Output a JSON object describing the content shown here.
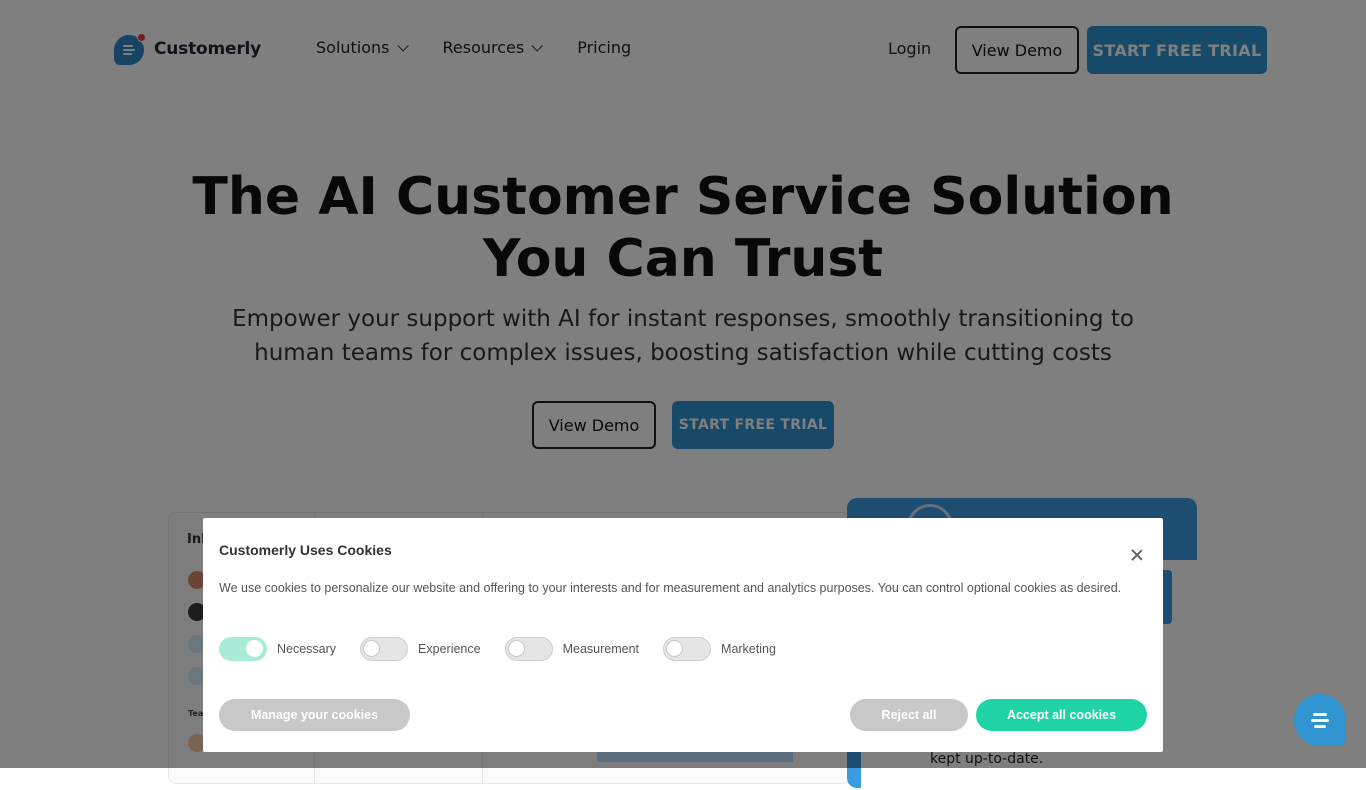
{
  "brand": {
    "name": "Customerly"
  },
  "nav": {
    "items": [
      {
        "label": "Solutions",
        "dropdown": true
      },
      {
        "label": "Resources",
        "dropdown": true
      },
      {
        "label": "Pricing",
        "dropdown": false
      }
    ],
    "login_label": "Login",
    "view_demo_label": "View Demo",
    "trial_label": "START FREE TRIAL"
  },
  "hero": {
    "title": "The AI Customer Service Solution You Can Trust",
    "subtitle": "Empower your support with AI for instant responses, smoothly transitioning to human teams for complex issues, boosting satisfaction while cutting costs",
    "view_demo_label": "View Demo",
    "trial_label": "START FREE TRIAL"
  },
  "preview": {
    "inbox_label": "Inb",
    "teams_label": "Team",
    "message_snippet": "kept up-to-date."
  },
  "cookie_banner": {
    "title": "Customerly Uses Cookies",
    "text": "We use cookies to personalize our website and offering to your interests and for measurement and analytics purposes. You can control optional cookies as desired.",
    "toggles": [
      {
        "label": "Necessary",
        "on": true
      },
      {
        "label": "Experience",
        "on": false
      },
      {
        "label": "Measurement",
        "on": false
      },
      {
        "label": "Marketing",
        "on": false
      }
    ],
    "manage_label": "Manage your cookies",
    "reject_label": "Reject all",
    "accept_label": "Accept all cookies"
  },
  "colors": {
    "primary": "#2f94d0",
    "accept": "#1ed4a6",
    "muted_button": "#c8c8c8"
  }
}
